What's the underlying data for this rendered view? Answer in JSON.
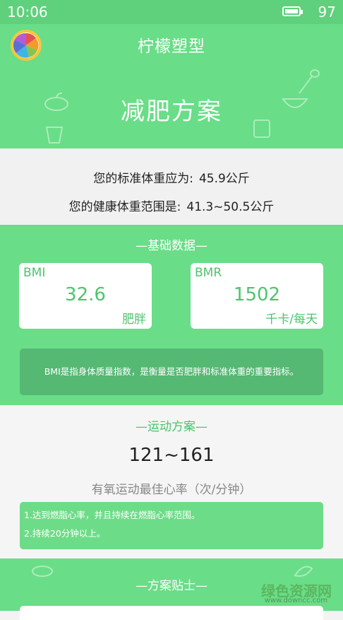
{
  "status_bar": {
    "time": "10:06",
    "battery": "97"
  },
  "header": {
    "app_title": "柠檬塑型",
    "main_title": "减肥方案"
  },
  "weight": {
    "standard_label": "您的标准体重应为:",
    "standard_value": "45.9公斤",
    "healthy_label": "您的健康体重范围是:",
    "healthy_value": "41.3~50.5公斤"
  },
  "basic_data": {
    "title": "—基础数据—",
    "bmi": {
      "label": "BMI",
      "value": "32.6",
      "status": "肥胖"
    },
    "bmr": {
      "label": "BMR",
      "value": "1502",
      "unit": "千卡/每天"
    },
    "note": "BMI是指身体质量指数，是衡量是否肥胖和标准体重的重要指标。"
  },
  "exercise": {
    "title": "—运动方案—",
    "heart_rate": "121~161",
    "heart_rate_label": "有氧运动最佳心率（次/分钟）",
    "tips": [
      "1.达到燃脂心率，并且持续在燃脂心率范围。",
      "2.持续20分钟以上。"
    ]
  },
  "plan_tips": {
    "title": "—方案贴士—"
  },
  "watermark": {
    "text": "绿色资源网",
    "url": "www.downcc.com"
  },
  "colors": {
    "primary": "#69dd87",
    "dark_green": "#55b873",
    "text": "#222222"
  }
}
